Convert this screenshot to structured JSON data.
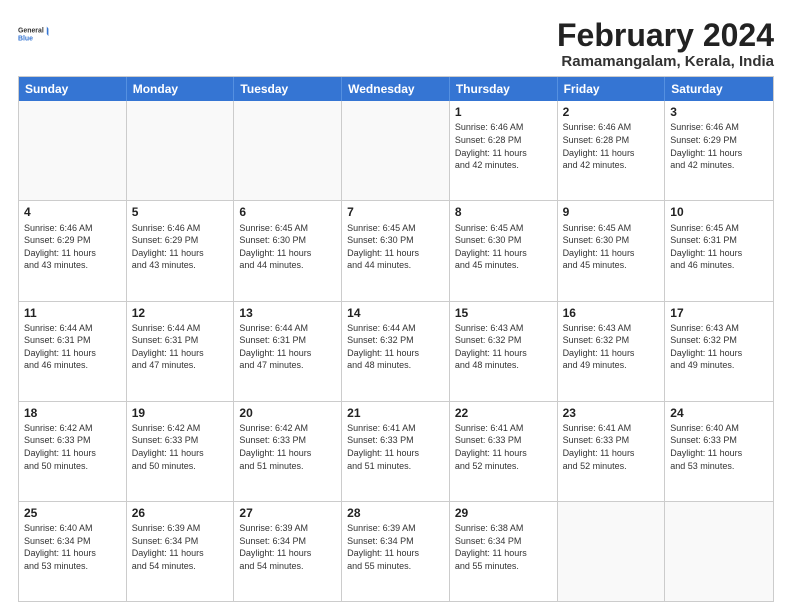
{
  "logo": {
    "line1": "General",
    "line2": "Blue"
  },
  "title": "February 2024",
  "subtitle": "Ramamangalam, Kerala, India",
  "headers": [
    "Sunday",
    "Monday",
    "Tuesday",
    "Wednesday",
    "Thursday",
    "Friday",
    "Saturday"
  ],
  "rows": [
    [
      {
        "day": "",
        "info": ""
      },
      {
        "day": "",
        "info": ""
      },
      {
        "day": "",
        "info": ""
      },
      {
        "day": "",
        "info": ""
      },
      {
        "day": "1",
        "info": "Sunrise: 6:46 AM\nSunset: 6:28 PM\nDaylight: 11 hours\nand 42 minutes."
      },
      {
        "day": "2",
        "info": "Sunrise: 6:46 AM\nSunset: 6:28 PM\nDaylight: 11 hours\nand 42 minutes."
      },
      {
        "day": "3",
        "info": "Sunrise: 6:46 AM\nSunset: 6:29 PM\nDaylight: 11 hours\nand 42 minutes."
      }
    ],
    [
      {
        "day": "4",
        "info": "Sunrise: 6:46 AM\nSunset: 6:29 PM\nDaylight: 11 hours\nand 43 minutes."
      },
      {
        "day": "5",
        "info": "Sunrise: 6:46 AM\nSunset: 6:29 PM\nDaylight: 11 hours\nand 43 minutes."
      },
      {
        "day": "6",
        "info": "Sunrise: 6:45 AM\nSunset: 6:30 PM\nDaylight: 11 hours\nand 44 minutes."
      },
      {
        "day": "7",
        "info": "Sunrise: 6:45 AM\nSunset: 6:30 PM\nDaylight: 11 hours\nand 44 minutes."
      },
      {
        "day": "8",
        "info": "Sunrise: 6:45 AM\nSunset: 6:30 PM\nDaylight: 11 hours\nand 45 minutes."
      },
      {
        "day": "9",
        "info": "Sunrise: 6:45 AM\nSunset: 6:30 PM\nDaylight: 11 hours\nand 45 minutes."
      },
      {
        "day": "10",
        "info": "Sunrise: 6:45 AM\nSunset: 6:31 PM\nDaylight: 11 hours\nand 46 minutes."
      }
    ],
    [
      {
        "day": "11",
        "info": "Sunrise: 6:44 AM\nSunset: 6:31 PM\nDaylight: 11 hours\nand 46 minutes."
      },
      {
        "day": "12",
        "info": "Sunrise: 6:44 AM\nSunset: 6:31 PM\nDaylight: 11 hours\nand 47 minutes."
      },
      {
        "day": "13",
        "info": "Sunrise: 6:44 AM\nSunset: 6:31 PM\nDaylight: 11 hours\nand 47 minutes."
      },
      {
        "day": "14",
        "info": "Sunrise: 6:44 AM\nSunset: 6:32 PM\nDaylight: 11 hours\nand 48 minutes."
      },
      {
        "day": "15",
        "info": "Sunrise: 6:43 AM\nSunset: 6:32 PM\nDaylight: 11 hours\nand 48 minutes."
      },
      {
        "day": "16",
        "info": "Sunrise: 6:43 AM\nSunset: 6:32 PM\nDaylight: 11 hours\nand 49 minutes."
      },
      {
        "day": "17",
        "info": "Sunrise: 6:43 AM\nSunset: 6:32 PM\nDaylight: 11 hours\nand 49 minutes."
      }
    ],
    [
      {
        "day": "18",
        "info": "Sunrise: 6:42 AM\nSunset: 6:33 PM\nDaylight: 11 hours\nand 50 minutes."
      },
      {
        "day": "19",
        "info": "Sunrise: 6:42 AM\nSunset: 6:33 PM\nDaylight: 11 hours\nand 50 minutes."
      },
      {
        "day": "20",
        "info": "Sunrise: 6:42 AM\nSunset: 6:33 PM\nDaylight: 11 hours\nand 51 minutes."
      },
      {
        "day": "21",
        "info": "Sunrise: 6:41 AM\nSunset: 6:33 PM\nDaylight: 11 hours\nand 51 minutes."
      },
      {
        "day": "22",
        "info": "Sunrise: 6:41 AM\nSunset: 6:33 PM\nDaylight: 11 hours\nand 52 minutes."
      },
      {
        "day": "23",
        "info": "Sunrise: 6:41 AM\nSunset: 6:33 PM\nDaylight: 11 hours\nand 52 minutes."
      },
      {
        "day": "24",
        "info": "Sunrise: 6:40 AM\nSunset: 6:33 PM\nDaylight: 11 hours\nand 53 minutes."
      }
    ],
    [
      {
        "day": "25",
        "info": "Sunrise: 6:40 AM\nSunset: 6:34 PM\nDaylight: 11 hours\nand 53 minutes."
      },
      {
        "day": "26",
        "info": "Sunrise: 6:39 AM\nSunset: 6:34 PM\nDaylight: 11 hours\nand 54 minutes."
      },
      {
        "day": "27",
        "info": "Sunrise: 6:39 AM\nSunset: 6:34 PM\nDaylight: 11 hours\nand 54 minutes."
      },
      {
        "day": "28",
        "info": "Sunrise: 6:39 AM\nSunset: 6:34 PM\nDaylight: 11 hours\nand 55 minutes."
      },
      {
        "day": "29",
        "info": "Sunrise: 6:38 AM\nSunset: 6:34 PM\nDaylight: 11 hours\nand 55 minutes."
      },
      {
        "day": "",
        "info": ""
      },
      {
        "day": "",
        "info": ""
      }
    ]
  ]
}
